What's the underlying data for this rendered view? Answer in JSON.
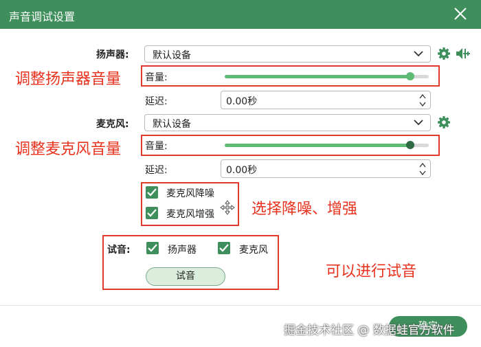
{
  "window": {
    "title": "声音调试设置"
  },
  "speaker": {
    "label": "扬声器:",
    "device": "默认设备",
    "volume_label": "音量:",
    "volume_level": 0.91,
    "delay_label": "延迟:",
    "delay_value": "0.00秒"
  },
  "mic": {
    "label": "麦克风:",
    "device": "默认设备",
    "volume_label": "音量:",
    "volume_level": 0.91,
    "delay_label": "延迟:",
    "delay_value": "0.00秒"
  },
  "options": {
    "noise_reduction": {
      "label": "麦克风降噪",
      "checked": true
    },
    "enhance": {
      "label": "麦克风增强",
      "checked": true
    }
  },
  "test": {
    "label": "试音:",
    "speaker": {
      "label": "扬声器",
      "checked": true
    },
    "mic": {
      "label": "麦克风",
      "checked": true
    },
    "button": "试音"
  },
  "footer": {
    "ok_button": "确定"
  },
  "annotations": {
    "speaker_volume": "调整扬声器音量",
    "mic_volume": "调整麦克风音量",
    "noise": "选择降噪、增强",
    "test": "可以进行试音"
  },
  "watermark": "掘金技术社区 @ 数据蛙官方软件",
  "colors": {
    "accent": "#3e8f5c",
    "slider_fill": "#5dbb74",
    "annotation": "#e8321e"
  },
  "icons": [
    "close-icon",
    "gear-icon",
    "speaker-volume-icon",
    "chevron-down-icon",
    "checkbox-check-icon",
    "move-cursor-icon"
  ]
}
